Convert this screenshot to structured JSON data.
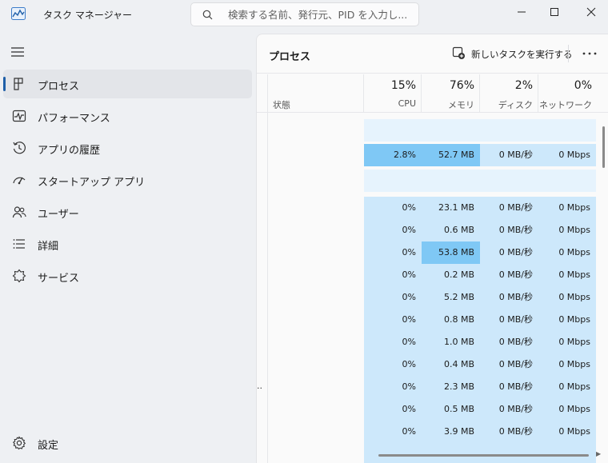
{
  "window": {
    "title": "タスク マネージャー",
    "search_placeholder": "検索する名前、発行元、PID を入力し..."
  },
  "sidebar": {
    "items": [
      {
        "label": "プロセス",
        "icon": "processes-icon",
        "active": true
      },
      {
        "label": "パフォーマンス",
        "icon": "performance-icon"
      },
      {
        "label": "アプリの履歴",
        "icon": "app-history-icon"
      },
      {
        "label": "スタートアップ アプリ",
        "icon": "startup-icon"
      },
      {
        "label": "ユーザー",
        "icon": "users-icon"
      },
      {
        "label": "詳細",
        "icon": "details-icon"
      },
      {
        "label": "サービス",
        "icon": "services-icon"
      }
    ],
    "settings_label": "設定"
  },
  "main": {
    "title": "プロセス",
    "new_task_label": "新しいタスクを実行する",
    "status_header": "状態",
    "tree_indicator": "..",
    "columns": [
      {
        "pct": "15%",
        "name": "CPU"
      },
      {
        "pct": "76%",
        "name": "メモリ"
      },
      {
        "pct": "2%",
        "name": "ディスク"
      },
      {
        "pct": "0%",
        "name": "ネットワーク"
      }
    ],
    "rows": [
      {
        "cpu": "2.8%",
        "mem": "52.7 MB",
        "disk": "0 MB/秒",
        "net": "0 Mbps"
      },
      {
        "cpu": "0%",
        "mem": "23.1 MB",
        "disk": "0 MB/秒",
        "net": "0 Mbps"
      },
      {
        "cpu": "0%",
        "mem": "0.6 MB",
        "disk": "0 MB/秒",
        "net": "0 Mbps"
      },
      {
        "cpu": "0%",
        "mem": "53.8 MB",
        "disk": "0 MB/秒",
        "net": "0 Mbps"
      },
      {
        "cpu": "0%",
        "mem": "0.2 MB",
        "disk": "0 MB/秒",
        "net": "0 Mbps"
      },
      {
        "cpu": "0%",
        "mem": "5.2 MB",
        "disk": "0 MB/秒",
        "net": "0 Mbps"
      },
      {
        "cpu": "0%",
        "mem": "0.8 MB",
        "disk": "0 MB/秒",
        "net": "0 Mbps"
      },
      {
        "cpu": "0%",
        "mem": "1.0 MB",
        "disk": "0 MB/秒",
        "net": "0 Mbps"
      },
      {
        "cpu": "0%",
        "mem": "0.4 MB",
        "disk": "0 MB/秒",
        "net": "0 Mbps"
      },
      {
        "cpu": "0%",
        "mem": "2.3 MB",
        "disk": "0 MB/秒",
        "net": "0 Mbps"
      },
      {
        "cpu": "0%",
        "mem": "0.5 MB",
        "disk": "0 MB/秒",
        "net": "0 Mbps"
      },
      {
        "cpu": "0%",
        "mem": "3.9 MB",
        "disk": "0 MB/秒",
        "net": "0 Mbps"
      }
    ]
  },
  "colors": {
    "heat_light": "#cde8fb",
    "heat_medium": "#a6d8f7",
    "heat_strong": "#7fc8f5",
    "accent": "#1f5fa8"
  }
}
